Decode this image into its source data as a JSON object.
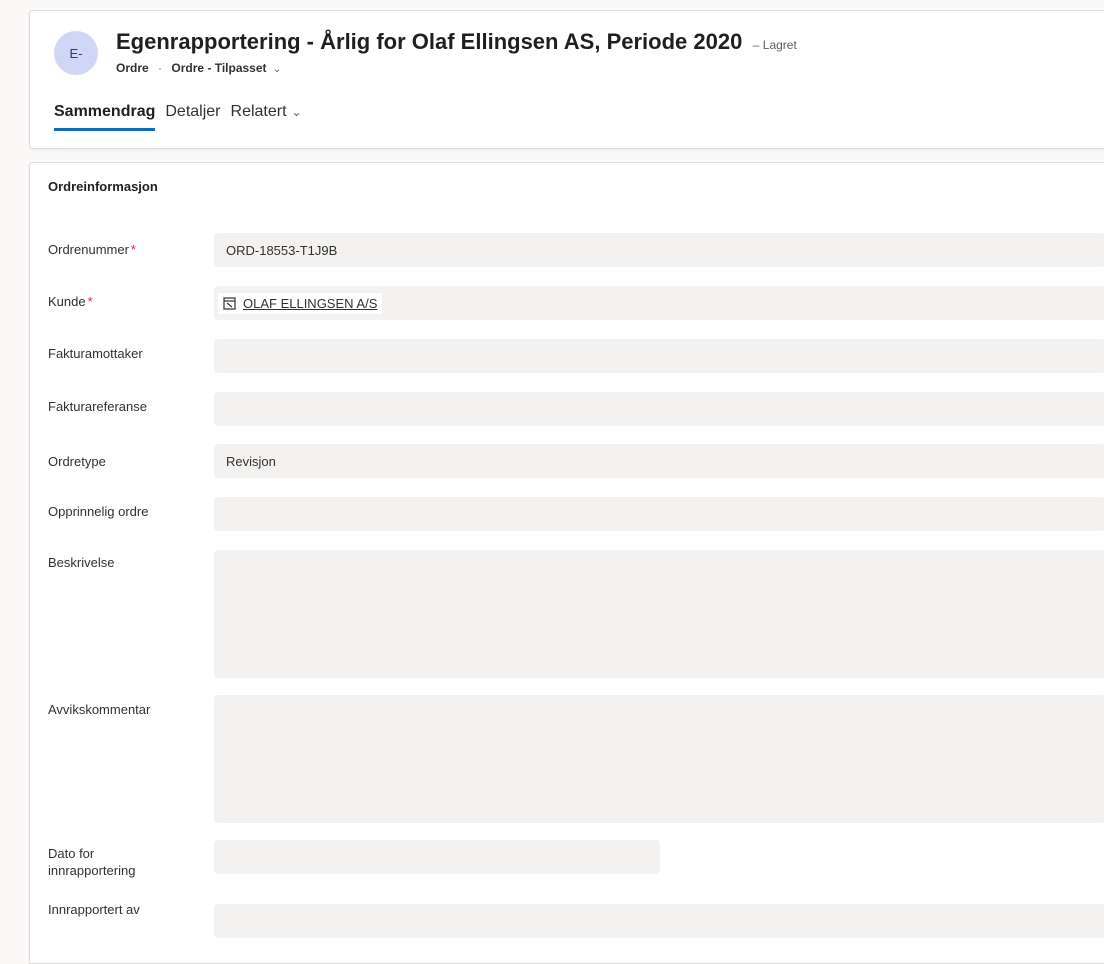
{
  "header": {
    "avatar_initials": "E-",
    "title": "Egenrapportering - Årlig for Olaf Ellingsen AS, Periode 2020",
    "save_status": "– Lagret",
    "entity": "Ordre",
    "separator": "·",
    "form_name": "Ordre - Tilpasset",
    "tabs": [
      {
        "label": "Sammendrag"
      },
      {
        "label": "Detaljer"
      },
      {
        "label": "Relatert"
      }
    ]
  },
  "section": {
    "title": "Ordreinformasjon"
  },
  "fields": {
    "ordrenummer": {
      "label": "Ordrenummer",
      "required": "*",
      "value": "ORD-18553-T1J9B"
    },
    "kunde": {
      "label": "Kunde",
      "required": "*",
      "value": "OLAF ELLINGSEN A/S",
      "icon": "account-icon"
    },
    "fakturamottaker": {
      "label": "Fakturamottaker",
      "value": ""
    },
    "fakturareferanse": {
      "label": "Fakturareferanse",
      "value": ""
    },
    "ordretype": {
      "label": "Ordretype",
      "value": "Revisjon"
    },
    "opprinnelig_ordre": {
      "label": "Opprinnelig ordre",
      "value": ""
    },
    "beskrivelse": {
      "label": "Beskrivelse",
      "value": ""
    },
    "avvikskommentar": {
      "label": "Avvikskommentar",
      "value": ""
    },
    "dato_innrapportering": {
      "label": "Dato for innrapportering",
      "value": ""
    },
    "innrapportert_av": {
      "label": "Innrapportert av",
      "value": ""
    }
  },
  "colors": {
    "accent": "#0f6cbd",
    "required": "#c4314b",
    "field_bg": "#f3f2f1",
    "avatar_bg": "#d0d6f5"
  }
}
